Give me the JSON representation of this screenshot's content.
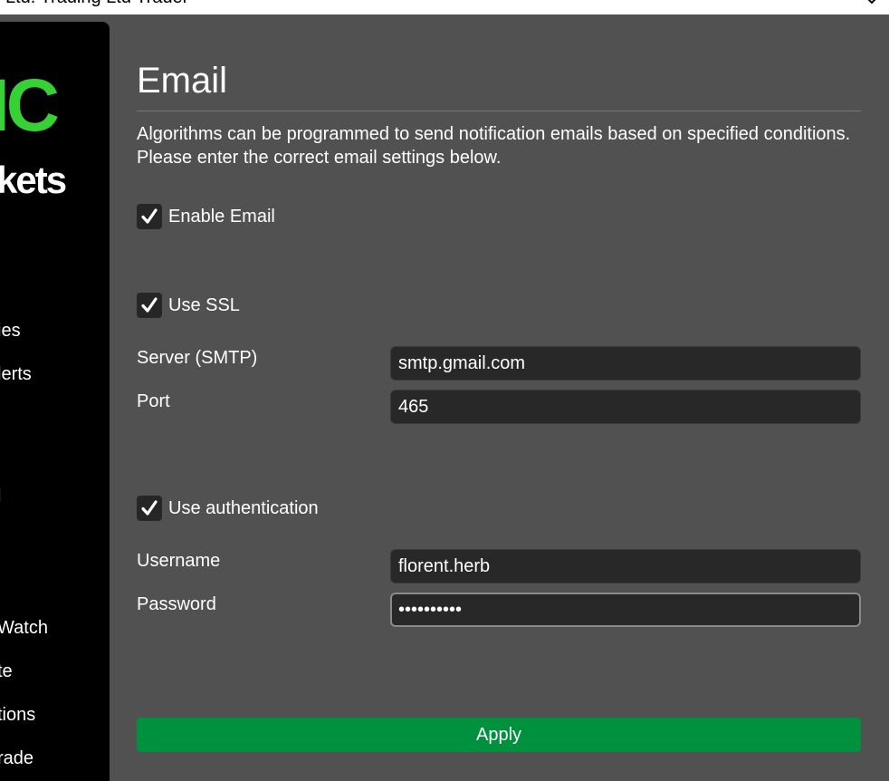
{
  "window": {
    "title": "Ltd. Trading Ltd Trader"
  },
  "sidebar": {
    "logo_top": "IC",
    "logo_bottom": "kets",
    "items": [
      {
        "label": "ies"
      },
      {
        "label": "lerts"
      },
      {
        "label": "l"
      },
      {
        "label": "Watch"
      },
      {
        "label": "te"
      },
      {
        "label": "tions"
      },
      {
        "label": "rade"
      }
    ]
  },
  "page": {
    "title": "Email",
    "description": "Algorithms can be programmed to send notification emails based on specified conditions. Please enter the correct email settings below."
  },
  "email": {
    "enable_label": "Enable Email",
    "enable_checked": true
  },
  "ssl": {
    "label": "Use SSL",
    "checked": true
  },
  "server": {
    "label": "Server (SMTP)",
    "value": "smtp.gmail.com"
  },
  "port": {
    "label": "Port",
    "value": "465"
  },
  "auth": {
    "label": "Use authentication",
    "checked": true
  },
  "username": {
    "label": "Username",
    "value": "florent.herb"
  },
  "password": {
    "label": "Password",
    "value": "••••••••••"
  },
  "actions": {
    "apply_label": "Apply"
  },
  "colors": {
    "background": "#515151",
    "sidebar": "#000000",
    "logo_green": "#35d135",
    "input_bg": "#282828",
    "apply_green": "#00913f"
  }
}
